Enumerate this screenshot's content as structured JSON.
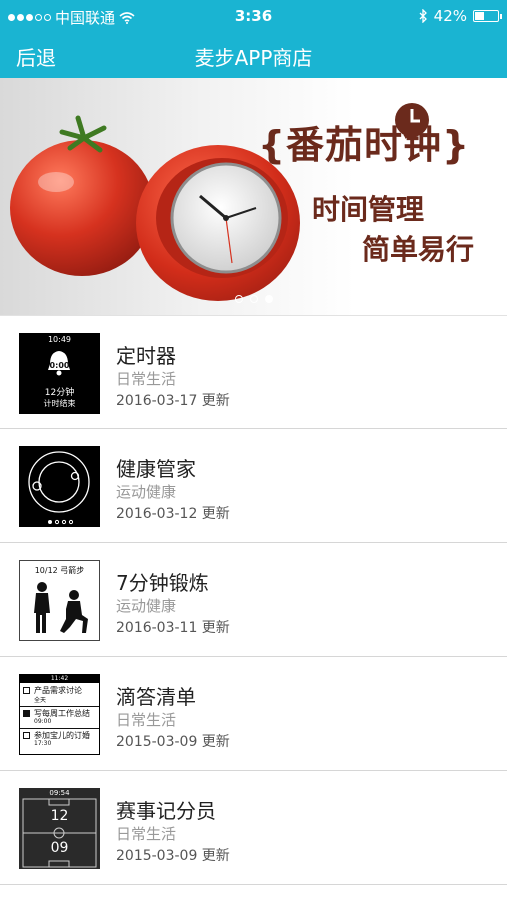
{
  "status": {
    "carrier": "中国联通",
    "time": "3:36",
    "battery": "42%",
    "battery_level": 0.42
  },
  "nav": {
    "back_label": "后退",
    "title": "麦步APP商店"
  },
  "banner": {
    "title": "{番茄时钟}",
    "line1": "时间管理",
    "line2": "简单易行",
    "page_count": 3,
    "active_page": 3
  },
  "apps": [
    {
      "name": "定时器",
      "category": "日常生活",
      "date": "2016-03-17 更新",
      "thumb": {
        "time": "10:49",
        "display": "0:00",
        "line1": "12分钟",
        "line2": "计时结束"
      }
    },
    {
      "name": "健康管家",
      "category": "运动健康",
      "date": "2016-03-12 更新",
      "thumb": {}
    },
    {
      "name": "7分钟锻炼",
      "category": "运动健康",
      "date": "2016-03-11 更新",
      "thumb": {
        "caption": "10/12 弓箭步"
      }
    },
    {
      "name": "滴答清单",
      "category": "日常生活",
      "date": "2015-03-09 更新",
      "thumb": {
        "time": "11:42",
        "tasks": [
          {
            "title": "产品需求讨论",
            "sub": "全天",
            "checked": false
          },
          {
            "title": "写每周工作总结",
            "sub": "09:00",
            "checked": true
          },
          {
            "title": "参加宝儿的订婚",
            "sub": "17:30",
            "checked": false
          }
        ]
      }
    },
    {
      "name": "赛事记分员",
      "category": "日常生活",
      "date": "2015-03-09 更新",
      "thumb": {
        "time": "09:54",
        "score_top": "12",
        "score_bottom": "09"
      }
    }
  ],
  "colors": {
    "header": "#1ab4d2",
    "banner_text": "#6b2a1c",
    "tomato": "#d6321f"
  }
}
